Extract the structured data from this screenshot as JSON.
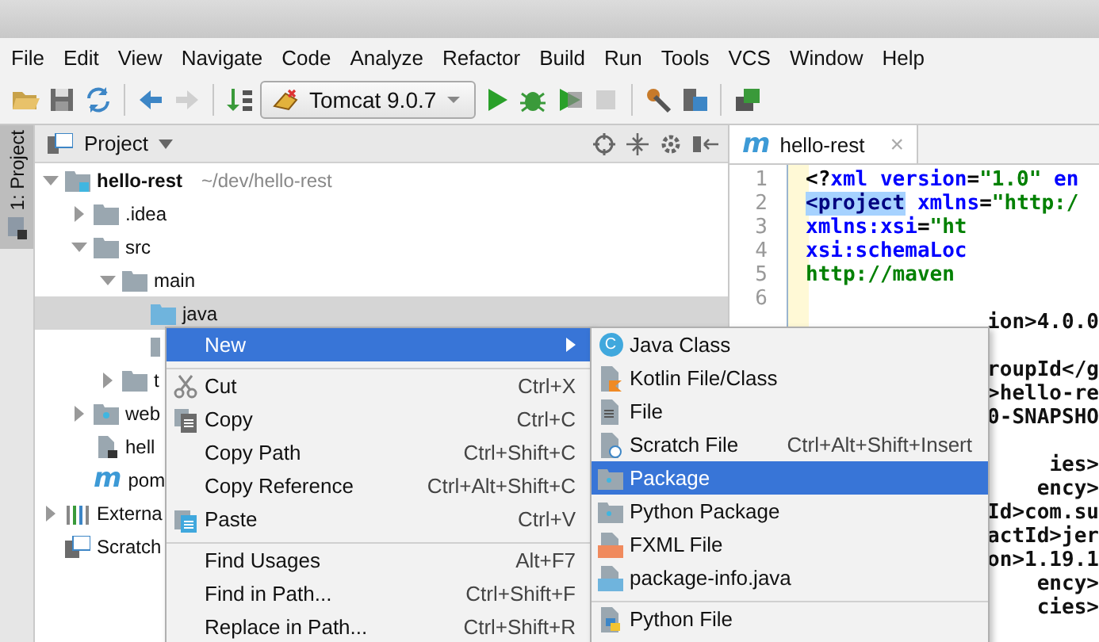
{
  "menu_bar": [
    "File",
    "Edit",
    "View",
    "Navigate",
    "Code",
    "Analyze",
    "Refactor",
    "Build",
    "Run",
    "Tools",
    "VCS",
    "Window",
    "Help"
  ],
  "toolbar": [
    {
      "kind": "open",
      "disabled": false
    },
    {
      "kind": "save",
      "disabled": false
    },
    {
      "kind": "sync",
      "disabled": false
    },
    {
      "kind": "sep"
    },
    {
      "kind": "back",
      "disabled": false
    },
    {
      "kind": "forward",
      "disabled": true
    },
    {
      "kind": "sep"
    },
    {
      "kind": "build",
      "disabled": false
    },
    {
      "kind": "config",
      "label": "Tomcat 9.0.7"
    },
    {
      "kind": "run",
      "disabled": false
    },
    {
      "kind": "debug",
      "disabled": false
    },
    {
      "kind": "coverage",
      "disabled": false
    },
    {
      "kind": "stop",
      "disabled": true
    },
    {
      "kind": "sep"
    },
    {
      "kind": "structure",
      "disabled": false
    },
    {
      "kind": "sdk",
      "disabled": false
    },
    {
      "kind": "sep"
    },
    {
      "kind": "database",
      "disabled": false
    }
  ],
  "tool_stripe": {
    "label": "1: Project",
    "selected": true
  },
  "project_panel": {
    "title": "Project",
    "tree": [
      {
        "kind": "module",
        "label": "hello-rest",
        "path": "~/dev/hello-rest",
        "expanded": true,
        "selected": false,
        "children": [
          {
            "kind": "folder",
            "label": ".idea",
            "expanded": false,
            "selected": false
          },
          {
            "kind": "folder",
            "label": "src",
            "expanded": true,
            "selected": false,
            "children": [
              {
                "kind": "folder",
                "label": "main",
                "expanded": true,
                "selected": false,
                "children": [
                  {
                    "kind": "source",
                    "label": "java",
                    "selected": true
                  },
                  {
                    "kind": "folder",
                    "selected": false
                  }
                ]
              },
              {
                "kind": "folder",
                "label": "t",
                "expanded": false,
                "selected": false
              }
            ]
          },
          {
            "kind": "web",
            "label": "web",
            "expanded": false,
            "selected": false
          },
          {
            "kind": "file",
            "label": "hell",
            "selected": false
          },
          {
            "kind": "pom",
            "icon_text": "m",
            "label": "pom",
            "selected": false
          }
        ]
      },
      {
        "kind": "library",
        "label": "Externa",
        "expanded": false,
        "selected": false
      },
      {
        "kind": "scratch",
        "label": "Scratch",
        "selected": false
      }
    ]
  },
  "editor": {
    "tab": {
      "icon_text": "m",
      "label": "hello-rest",
      "close": "×",
      "selected": true
    },
    "lines": [
      {
        "number": "1",
        "segments": [
          {
            "kind": "text",
            "text": "<?"
          },
          {
            "kind": "attr",
            "text": "xml version"
          },
          {
            "kind": "text",
            "text": "="
          },
          {
            "kind": "value",
            "text": "\"1.0\""
          },
          {
            "kind": "attr",
            "text": " en"
          }
        ]
      },
      {
        "number": "2",
        "segments": [
          {
            "kind": "selected_tag",
            "text": "<project"
          },
          {
            "kind": "attr",
            "text": " xmlns"
          },
          {
            "kind": "text",
            "text": "="
          },
          {
            "kind": "value",
            "text": "\"http:/"
          }
        ]
      },
      {
        "number": "3",
        "segments": [
          {
            "kind": "attr",
            "text": "         xmlns:xsi"
          },
          {
            "kind": "text",
            "text": "="
          },
          {
            "kind": "value",
            "text": "\"ht"
          }
        ]
      },
      {
        "number": "4",
        "segments": [
          {
            "kind": "attr",
            "text": "         xsi:schemaLoc"
          }
        ]
      },
      {
        "number": "5",
        "segments": [
          {
            "kind": "value",
            "text": "         http://maven"
          }
        ]
      },
      {
        "number": "6"
      }
    ],
    "covered_blocks": [
      [
        "ion>4.0.0"
      ],
      [
        "roupId</g",
        ">hello-re",
        "0-SNAPSHO"
      ],
      [
        "ies>",
        "ency>",
        "Id>com.su",
        "actId>jer",
        "on>1.19.1",
        "ency>",
        "cies>"
      ]
    ]
  },
  "context_menu": [
    {
      "kind": "submenu",
      "label": "New",
      "selected": true
    },
    {
      "kind": "separator"
    },
    {
      "kind": "cut",
      "label": "Cut",
      "shortcut": "Ctrl+X",
      "selected": false
    },
    {
      "kind": "copy",
      "label": "Copy",
      "shortcut": "Ctrl+C",
      "selected": false
    },
    {
      "kind": "item",
      "label": "Copy Path",
      "shortcut": "Ctrl+Shift+C",
      "selected": false
    },
    {
      "kind": "item",
      "label": "Copy Reference",
      "shortcut": "Ctrl+Alt+Shift+C",
      "selected": false
    },
    {
      "kind": "paste",
      "label": "Paste",
      "shortcut": "Ctrl+V",
      "selected": false
    },
    {
      "kind": "separator"
    },
    {
      "kind": "item",
      "label": "Find Usages",
      "shortcut": "Alt+F7",
      "selected": false
    },
    {
      "kind": "item",
      "label": "Find in Path...",
      "shortcut": "Ctrl+Shift+F",
      "selected": false
    },
    {
      "kind": "item",
      "label": "Replace in Path...",
      "shortcut": "Ctrl+Shift+R",
      "selected": false
    }
  ],
  "submenu": [
    {
      "kind": "class",
      "icon_text": "C",
      "label": "Java Class",
      "selected": false
    },
    {
      "kind": "kotlin",
      "label": "Kotlin File/Class",
      "selected": false
    },
    {
      "kind": "file",
      "label": "File",
      "selected": false
    },
    {
      "kind": "scratch",
      "label": "Scratch File",
      "shortcut": "Ctrl+Alt+Shift+Insert",
      "selected": false
    },
    {
      "kind": "package",
      "label": "Package",
      "selected": true
    },
    {
      "kind": "package",
      "label": "Python Package",
      "selected": false
    },
    {
      "kind": "fxml",
      "label": "FXML File",
      "selected": false
    },
    {
      "kind": "javafile",
      "label": "package-info.java",
      "selected": false
    },
    {
      "kind": "separator"
    },
    {
      "kind": "python",
      "label": "Python File",
      "selected": false
    }
  ]
}
